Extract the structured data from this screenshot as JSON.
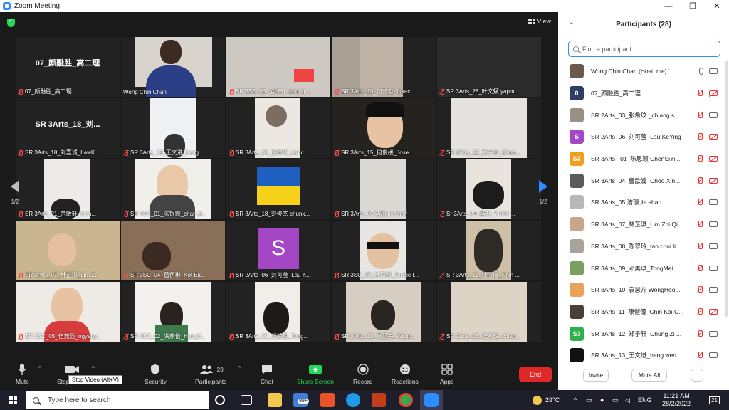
{
  "window": {
    "title": "Zoom Meeting",
    "controls": {
      "minimize": "—",
      "maximize": "❐",
      "close": "✕"
    }
  },
  "view_button": "View",
  "page_indicator": {
    "left": "1/2",
    "right": "1/2"
  },
  "tiles": [
    {
      "label": "07_颜融胜_高二理",
      "center_name": "07_颜融胜_高二理",
      "muted": true,
      "kind": "name"
    },
    {
      "label": "Wong Chin Chan",
      "muted": false,
      "kind": "video",
      "scene": "man"
    },
    {
      "label": "SR 3SC_08_梁玮轩_Leong ...",
      "muted": true,
      "kind": "video",
      "scene": "wall"
    },
    {
      "label": "SR 3Arts_15_何芸淼_Isaac ...",
      "muted": true,
      "kind": "video",
      "scene": "door"
    },
    {
      "label": "SR 3Arts_28_叶文斌 yapm...",
      "muted": true,
      "kind": "video",
      "scene": "dark"
    },
    {
      "label": "SR 3Arts_18_刘嘉诚_LawK...",
      "center_name": "SR 3Arts_18_刘...",
      "muted": true,
      "kind": "name"
    },
    {
      "label": "SR 3Arts_13_王文进_heng ...",
      "muted": true,
      "kind": "video",
      "scene": "window"
    },
    {
      "label": "SR 3Arts_08_陈翠玲_tan c...",
      "muted": true,
      "kind": "video",
      "scene": "ceiling"
    },
    {
      "label": "SR 3Arts_15_何俊楼_Jose...",
      "muted": true,
      "kind": "video",
      "scene": "boy",
      "active": true
    },
    {
      "label": "SR 3Arts_12_郑子轩_Chun...",
      "muted": true,
      "kind": "video",
      "scene": "room"
    },
    {
      "label": "SR 3Arts_21_范敏轩_loon...",
      "muted": true,
      "kind": "video",
      "scene": "fan"
    },
    {
      "label": "SR 3SC_01_陈银霞_chan yi...",
      "muted": true,
      "kind": "video",
      "scene": "girl"
    },
    {
      "label": "SR 3Arts_18_刘俊杰 chunk...",
      "muted": true,
      "kind": "flag"
    },
    {
      "label": "SR 3Arts_05 洁璟 jie shan",
      "muted": true,
      "kind": "video",
      "scene": "ceiling2"
    },
    {
      "label": "Sr 3Arts_29_杨升_YEOH...",
      "muted": true,
      "kind": "video",
      "scene": "hair"
    },
    {
      "label": "SR 3Arts_07_林芷淇_Lim Z...",
      "muted": true,
      "kind": "video",
      "scene": "girl2"
    },
    {
      "label": "SR 3SC_04_葛伊琳_Kot Ela...",
      "muted": true,
      "kind": "video",
      "scene": "room2"
    },
    {
      "label": "SR 2Arts_06_刘可莹_Lau K...",
      "muted": true,
      "kind": "letter",
      "letter": "S"
    },
    {
      "label": "SR 3SC_03_林嘉婷_Janice l...",
      "muted": true,
      "kind": "video",
      "scene": "sunglasses"
    },
    {
      "label": "SR 3Arts_11_陳愷儀_Chin ...",
      "muted": true,
      "kind": "video",
      "scene": "cartoon"
    },
    {
      "label": "SR 3SC_05_伍燕盈_ngyany...",
      "muted": true,
      "kind": "video",
      "scene": "glasses"
    },
    {
      "label": "SR 3SC_02_洪燕怡_HongY...",
      "muted": true,
      "kind": "video",
      "scene": "girl3"
    },
    {
      "label": "SR 3Arts_09_邓美琪_Tong...",
      "muted": true,
      "kind": "video",
      "scene": "girl4"
    },
    {
      "label": "SR 3Arts_10_袁慧卉_Wong...",
      "muted": true,
      "kind": "video",
      "scene": "girl5"
    },
    {
      "label": "SR 2Arts_03_张希玟_chian...",
      "muted": true,
      "kind": "video",
      "scene": "room3"
    }
  ],
  "toolbar": {
    "mute": "Mute",
    "stop_video": "Stop Video",
    "tooltip": "Stop Video (Alt+V)",
    "security": "Security",
    "participants": "Participants",
    "participants_count": "28",
    "chat": "Chat",
    "share_screen": "Share Screen",
    "record": "Record",
    "reactions": "Reactions",
    "apps": "Apps",
    "end": "End"
  },
  "panel": {
    "title": "Participants (28)",
    "search_placeholder": "Find a participant",
    "participants": [
      {
        "name": "Wong Chin Chan (Host, me)",
        "avatar_text": "",
        "avatar_color": "#6b5a4a",
        "mic": "on",
        "cam": "on"
      },
      {
        "name": "07_颜融胜_高二理",
        "avatar_text": "0",
        "avatar_color": "#2d3e66",
        "mic": "off",
        "cam": "off"
      },
      {
        "name": "SR 2Arts_03_张希玟 _chiang s...",
        "avatar_text": "",
        "avatar_color": "#9a8f80",
        "mic": "off",
        "cam": "on"
      },
      {
        "name": "SR 2Arts_06_刘可莹_Lau KeYing",
        "avatar_text": "S",
        "avatar_color": "#a347c4",
        "mic": "off",
        "cam": "off"
      },
      {
        "name": "SR 3Arts _01_陈思颖 ChenSiYi...",
        "avatar_text": "S3",
        "avatar_color": "#f0a020",
        "mic": "off",
        "cam": "off"
      },
      {
        "name": "SR 3Arts_04_曹歆媛_Choo Xin ...",
        "avatar_text": "",
        "avatar_color": "#5a5a5a",
        "mic": "off",
        "cam": "off"
      },
      {
        "name": "SR 3Arts_05 洁璟 jie shan",
        "avatar_text": "",
        "avatar_color": "#b8b8b8",
        "mic": "off",
        "cam": "on"
      },
      {
        "name": "SR 3Arts_07_林芷淇_Lim Zhi Qi",
        "avatar_text": "",
        "avatar_color": "#c9a58a",
        "mic": "off",
        "cam": "on"
      },
      {
        "name": "SR 3Arts_08_陈翠玲_tan chui li...",
        "avatar_text": "",
        "avatar_color": "#a9a39a",
        "mic": "off",
        "cam": "on"
      },
      {
        "name": "SR 3Arts_09_邓美琪_TongMei...",
        "avatar_text": "",
        "avatar_color": "#7aa060",
        "mic": "off",
        "cam": "on"
      },
      {
        "name": "SR 3Arts_10_袁慧卉 WongHoo...",
        "avatar_text": "",
        "avatar_color": "#e7a35a",
        "mic": "off",
        "cam": "on"
      },
      {
        "name": "SR 3Arts_11_陳愷儀_Chin Kai C...",
        "avatar_text": "",
        "avatar_color": "#4a3e38",
        "mic": "off",
        "cam": "off"
      },
      {
        "name": "SR 3Arts_12_郑子轩_Chung Zi ...",
        "avatar_text": "S3",
        "avatar_color": "#2fae4e",
        "mic": "off",
        "cam": "on"
      },
      {
        "name": "SR 3Arts_13_王文进_heng wen...",
        "avatar_text": "",
        "avatar_color": "#111111",
        "mic": "off",
        "cam": "on"
      }
    ],
    "invite": "Invite",
    "mute_all": "Mute All",
    "more": "..."
  },
  "taskbar": {
    "search_placeholder": "Type here to search",
    "mail_badge": "99+",
    "weather": "29°C",
    "language": "ENG",
    "time": "11:21 AM",
    "date": "28/2/2022",
    "notifications": "21"
  },
  "colors": {
    "zoom_blue": "#2d8cff",
    "end_red": "#e02828",
    "active_speaker": "#e6e35a",
    "share_green": "#23d959"
  }
}
